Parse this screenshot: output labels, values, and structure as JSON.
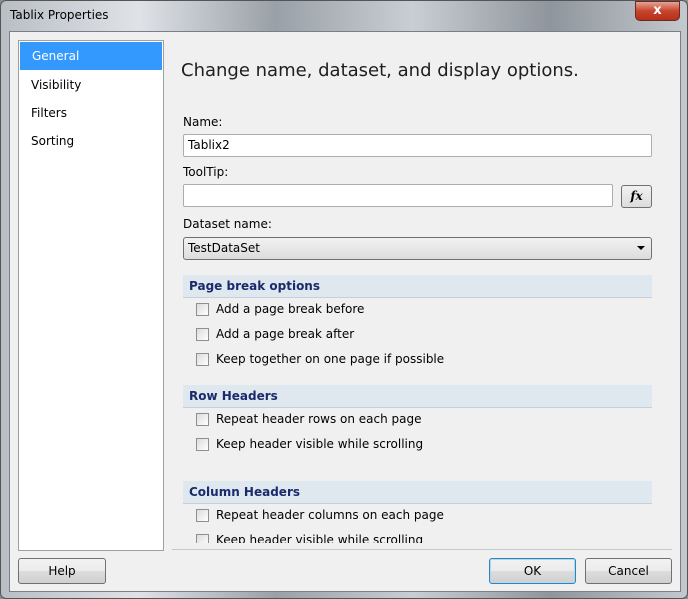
{
  "window": {
    "title": "Tablix Properties",
    "close_label": "x"
  },
  "sidebar": {
    "items": [
      {
        "label": "General",
        "selected": true
      },
      {
        "label": "Visibility"
      },
      {
        "label": "Filters"
      },
      {
        "label": "Sorting"
      }
    ]
  },
  "main": {
    "heading": "Change name, dataset, and display options.",
    "name_label": "Name:",
    "name_value": "Tablix2",
    "tooltip_label": "ToolTip:",
    "tooltip_value": "",
    "fx_label": "fx",
    "dataset_label": "Dataset name:",
    "dataset_value": "TestDataSet",
    "sections": [
      {
        "title": "Page break options",
        "options": [
          "Add a page break before",
          "Add a page break after",
          "Keep together on one page if possible"
        ]
      },
      {
        "title": "Row Headers",
        "options": [
          "Repeat header rows on each page",
          "Keep header visible while scrolling"
        ]
      },
      {
        "title": "Column Headers",
        "options": [
          "Repeat header columns on each page",
          "Keep header visible while scrolling"
        ]
      }
    ]
  },
  "buttons": {
    "help": "Help",
    "ok": "OK",
    "cancel": "Cancel"
  },
  "colors": {
    "selection": "#3399ff",
    "section_header_text": "#1b2a6b",
    "section_header_bg": "#dfe7ef"
  }
}
